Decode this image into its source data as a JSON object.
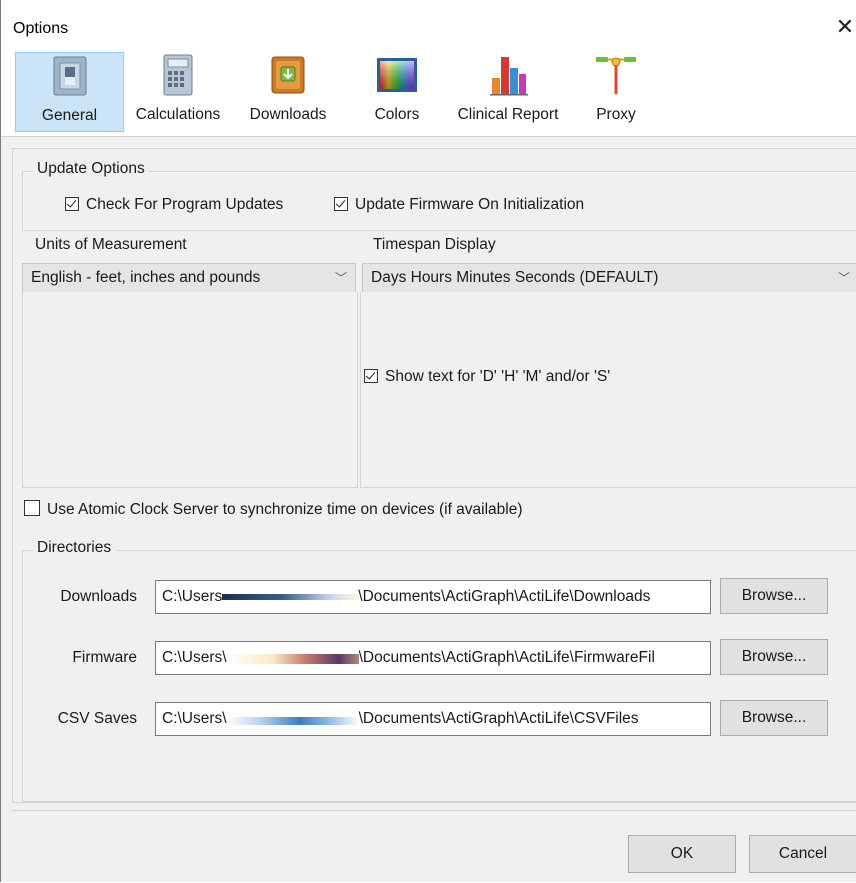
{
  "window": {
    "title": "Options",
    "close_glyph": "✕"
  },
  "toolbar": {
    "items": [
      {
        "label": "General",
        "icon": "switch-icon",
        "selected": true
      },
      {
        "label": "Calculations",
        "icon": "calculator-icon",
        "selected": false
      },
      {
        "label": "Downloads",
        "icon": "download-box-icon",
        "selected": false
      },
      {
        "label": "Colors",
        "icon": "color-palette-icon",
        "selected": false
      },
      {
        "label": "Clinical Report",
        "icon": "bar-chart-icon",
        "selected": false
      },
      {
        "label": "Proxy",
        "icon": "network-proxy-icon",
        "selected": false
      }
    ]
  },
  "update_options": {
    "title": "Update Options",
    "check_program_updates": {
      "label": "Check For Program Updates",
      "checked": true
    },
    "update_firmware": {
      "label": "Update Firmware On Initialization",
      "checked": true
    }
  },
  "units": {
    "title": "Units of Measurement",
    "selected": "English - feet, inches and pounds"
  },
  "timespan": {
    "title": "Timespan Display",
    "selected": "Days Hours Minutes Seconds (DEFAULT)",
    "show_text": {
      "label": "Show text for 'D' 'H' 'M' and/or 'S'",
      "checked": true
    }
  },
  "atomic_clock": {
    "label": "Use Atomic Clock Server to synchronize time on devices (if available)",
    "checked": false
  },
  "directories": {
    "title": "Directories",
    "rows": [
      {
        "label": "Downloads",
        "prefix": "C:\\Users",
        "suffix": "\\Documents\\ActiGraph\\ActiLife\\Downloads",
        "browse": "Browse..."
      },
      {
        "label": "Firmware",
        "prefix": "C:\\Users\\",
        "suffix": "\\Documents\\ActiGraph\\ActiLife\\FirmwareFil",
        "browse": "Browse..."
      },
      {
        "label": "CSV Saves",
        "prefix": "C:\\Users\\",
        "suffix": "\\Documents\\ActiGraph\\ActiLife\\CSVFiles",
        "browse": "Browse..."
      }
    ]
  },
  "footer": {
    "ok": "OK",
    "cancel": "Cancel"
  }
}
